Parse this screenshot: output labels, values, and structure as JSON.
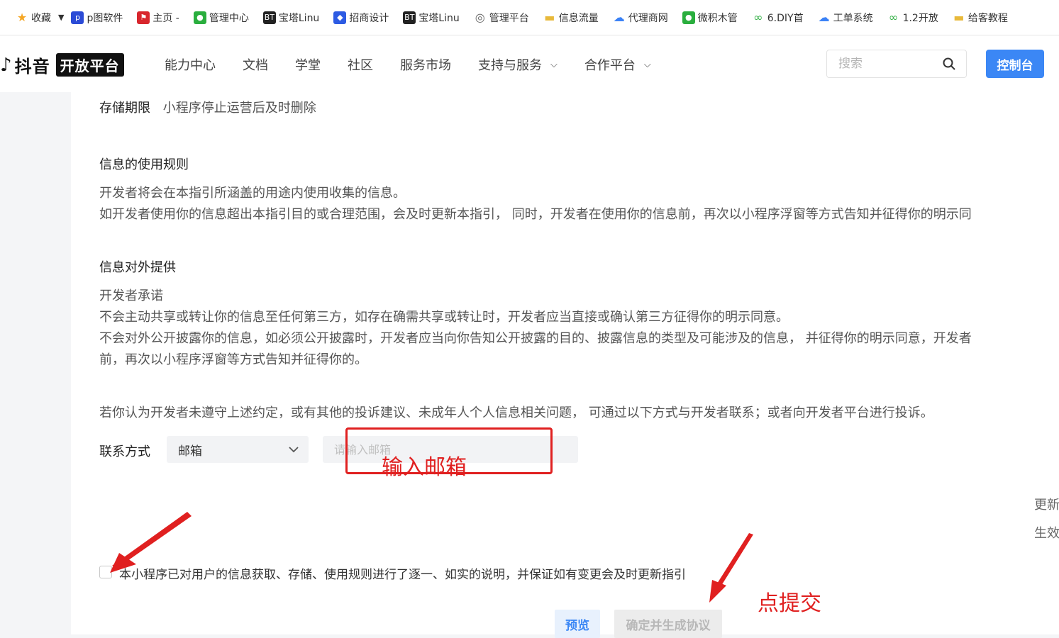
{
  "bookmarks": [
    {
      "label": "收藏",
      "icon": "star-icon",
      "color": "#f5a623"
    },
    {
      "label": "p图软件",
      "icon": "ptu-icon",
      "color": "#2b4bd6"
    },
    {
      "label": "主页 -",
      "icon": "flag-icon",
      "color": "#d8262d"
    },
    {
      "label": "管理中心",
      "icon": "wechat-icon",
      "color": "#2aae3e"
    },
    {
      "label": "宝塔Linu",
      "icon": "bt-icon",
      "color": "#222222"
    },
    {
      "label": "招商设计",
      "icon": "cube-icon",
      "color": "#2d5be3"
    },
    {
      "label": "宝塔Linu",
      "icon": "bt-icon",
      "color": "#222222"
    },
    {
      "label": "管理平台",
      "icon": "globe-icon",
      "color": "#666666"
    },
    {
      "label": "信息流量",
      "icon": "folder-icon",
      "color": "#e8b93a"
    },
    {
      "label": "代理商网",
      "icon": "cloud-icon",
      "color": "#3b82f6"
    },
    {
      "label": "微积木管",
      "icon": "wechat-icon",
      "color": "#2aae3e"
    },
    {
      "label": "6.DIY首",
      "icon": "loop-icon",
      "color": "#38b24a"
    },
    {
      "label": "工单系统",
      "icon": "cloud-icon",
      "color": "#3b82f6"
    },
    {
      "label": "1.2开放",
      "icon": "loop-icon",
      "color": "#38b24a"
    },
    {
      "label": "给客教程",
      "icon": "folder-icon",
      "color": "#e8b93a"
    }
  ],
  "header": {
    "logo_text": "抖音",
    "logo_badge": "开放平台",
    "nav": [
      "能力中心",
      "文档",
      "学堂",
      "社区",
      "服务市场",
      "支持与服务",
      "合作平台"
    ],
    "search_placeholder": "搜索",
    "console_label": "控制台"
  },
  "content": {
    "storage_label": "存储期限",
    "storage_value": "小程序停止运营后及时删除",
    "usage_title": "信息的使用规则",
    "usage_lines": [
      "开发者将会在本指引所涵盖的用途内使用收集的信息。",
      "如开发者使用你的信息超出本指引目的或合理范围，会及时更新本指引， 同时，开发者在使用你的信息前，再次以小程序浮窗等方式告知并征得你的明示同"
    ],
    "provide_title": "信息对外提供",
    "provide_lines": [
      "开发者承诺",
      "不会主动共享或转让你的信息至任何第三方，如存在确需共享或转让时，开发者应当直接或确认第三方征得你的明示同意。",
      "不会对外公开披露你的信息，如必须公开披露时，开发者应当向你告知公开披露的目的、披露信息的类型及可能涉及的信息， 并征得你的明示同意，开发者",
      "前，再次以小程序浮窗等方式告知并征得你的。"
    ],
    "complaint_text": "若你认为开发者未遵守上述约定，或有其他的投诉建议、未成年人个人信息相关问题， 可通过以下方式与开发者联系；或者向开发者平台进行投诉。",
    "contact_label": "联系方式",
    "contact_select_value": "邮箱",
    "email_placeholder": "请输入邮箱",
    "side_notes": [
      "更新",
      "生效"
    ],
    "agree_text": "本小程序已对用户的信息获取、存储、使用规则进行了逐一、如实的说明，并保证如有变更会及时更新指引",
    "preview_label": "预览",
    "confirm_label": "确定并生成协议"
  },
  "annotations": {
    "input_hint": "输入邮箱",
    "submit_hint": "点提交",
    "color": "#e02020"
  }
}
